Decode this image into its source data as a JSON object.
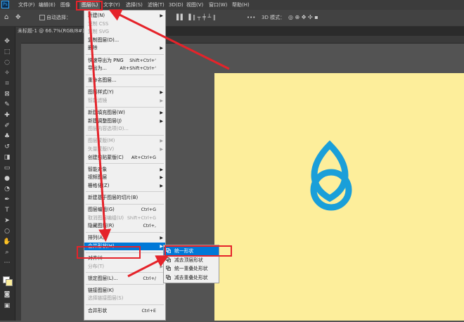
{
  "menubar": {
    "logo": "Ps",
    "items": [
      "文件(F)",
      "编辑(E)",
      "图像",
      "图层(L)",
      "文字(Y)",
      "选择(S)",
      "滤镜(T)",
      "3D(D)",
      "视图(V)",
      "窗口(W)",
      "帮助(H)"
    ]
  },
  "options": {
    "auto_select": "自动选择：",
    "more": "•••",
    "mode_3d": "3D 模式："
  },
  "document": {
    "tab_title": "未标题-1 @ 66.7%(RGB/8#)"
  },
  "layer_menu": {
    "items": [
      {
        "label": "新建(N)",
        "shortcut": "",
        "submenu": true,
        "disabled": false
      },
      {
        "label": "复制 CSS",
        "shortcut": "",
        "submenu": false,
        "disabled": true
      },
      {
        "label": "复制 SVG",
        "shortcut": "",
        "submenu": false,
        "disabled": true
      },
      {
        "label": "复制图层(D)...",
        "shortcut": "",
        "submenu": false,
        "disabled": false
      },
      {
        "label": "删除",
        "shortcut": "",
        "submenu": true,
        "disabled": false
      },
      {
        "label": "快速导出为 PNG",
        "shortcut": "Shift+Ctrl+'",
        "submenu": false,
        "disabled": false
      },
      {
        "label": "导出为...",
        "shortcut": "Alt+Shift+Ctrl+'",
        "submenu": false,
        "disabled": false
      },
      {
        "label": "重命名图层...",
        "shortcut": "",
        "submenu": false,
        "disabled": false
      },
      {
        "label": "图层样式(Y)",
        "shortcut": "",
        "submenu": true,
        "disabled": false
      },
      {
        "label": "智能滤镜",
        "shortcut": "",
        "submenu": true,
        "disabled": true
      },
      {
        "label": "新建填充图层(W)",
        "shortcut": "",
        "submenu": true,
        "disabled": false
      },
      {
        "label": "新建调整图层(J)",
        "shortcut": "",
        "submenu": true,
        "disabled": false
      },
      {
        "label": "图层内容选项(O)...",
        "shortcut": "",
        "submenu": false,
        "disabled": true
      },
      {
        "label": "图层蒙版(M)",
        "shortcut": "",
        "submenu": true,
        "disabled": true
      },
      {
        "label": "矢量蒙版(V)",
        "shortcut": "",
        "submenu": true,
        "disabled": true
      },
      {
        "label": "创建剪贴蒙版(C)",
        "shortcut": "Alt+Ctrl+G",
        "submenu": false,
        "disabled": false
      },
      {
        "label": "智能对象",
        "shortcut": "",
        "submenu": true,
        "disabled": false
      },
      {
        "label": "视频图层",
        "shortcut": "",
        "submenu": true,
        "disabled": false
      },
      {
        "label": "栅格化(Z)",
        "shortcut": "",
        "submenu": true,
        "disabled": false
      },
      {
        "label": "新建基于图层的切片(B)",
        "shortcut": "",
        "submenu": false,
        "disabled": false
      },
      {
        "label": "图层编组(G)",
        "shortcut": "Ctrl+G",
        "submenu": false,
        "disabled": false
      },
      {
        "label": "取消图层编组(U)",
        "shortcut": "Shift+Ctrl+G",
        "submenu": false,
        "disabled": true
      },
      {
        "label": "隐藏图层(R)",
        "shortcut": "Ctrl+,",
        "submenu": false,
        "disabled": false
      },
      {
        "label": "排列(A)",
        "shortcut": "",
        "submenu": true,
        "disabled": false
      },
      {
        "label": "合并形状(H)",
        "shortcut": "",
        "submenu": true,
        "disabled": false
      },
      {
        "label": "对齐(I)",
        "shortcut": "",
        "submenu": true,
        "disabled": false
      },
      {
        "label": "分布(T)",
        "shortcut": "",
        "submenu": true,
        "disabled": true
      },
      {
        "label": "锁定图层(L)...",
        "shortcut": "Ctrl+/",
        "submenu": false,
        "disabled": false
      },
      {
        "label": "链接图层(K)",
        "shortcut": "",
        "submenu": false,
        "disabled": false
      },
      {
        "label": "选择链接图层(S)",
        "shortcut": "",
        "submenu": false,
        "disabled": true
      },
      {
        "label": "合并形状",
        "shortcut": "Ctrl+E",
        "submenu": false,
        "disabled": false
      }
    ]
  },
  "merge_submenu": {
    "items": [
      "统一形状",
      "减去顶层形状",
      "统一重叠处形状",
      "减去重叠处形状"
    ]
  },
  "colors": {
    "canvas": "#fdee9b",
    "shape_stroke": "#1a9fd9",
    "highlight": "#0078d7",
    "annotation": "#e5232a"
  }
}
